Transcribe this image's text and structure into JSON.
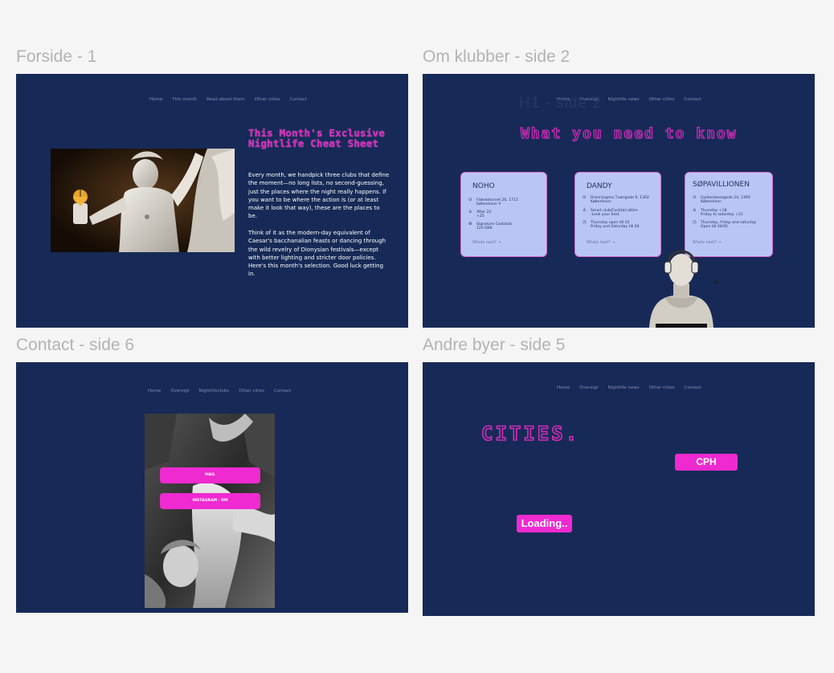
{
  "labels": {
    "frame1": "Forside - 1",
    "frame2": "Om klubber - side 2",
    "frame6": "Contact - side 6",
    "frame5": "Andre byer - side 5"
  },
  "frame1": {
    "nav": [
      "Home",
      "This month",
      "Read about them",
      "Other cities",
      "Contact"
    ],
    "heading": "This Month's Exclusive Nightlife Cheat Sheet",
    "para1": "Every month, we handpick three clubs that define the moment—no long lists, no second-guessing, just the places where the night really happens. If you want to be where the action is (or at least make it look that way), these are the places to be.",
    "para2": "Think of it as the modern-day equivalent of Caesar's bacchanalian feasts or dancing through the wild revelry of Dionysian festivals—except with better lighting and stricter door policies. Here's this month's selection. Good luck getting in."
  },
  "frame2": {
    "nav": [
      "Home",
      "Oversigt",
      "Nightlife news",
      "Other cities",
      "Contact"
    ],
    "ghost_heading": "H1 - side 2",
    "heading": "What you need to know",
    "cards": [
      {
        "title": "NOHO",
        "rows": [
          {
            "icon": "location-icon",
            "glyph": "⊙",
            "text": "Flæsketorvet 26, 1711\nKøbenhavn V"
          },
          {
            "icon": "person-icon",
            "glyph": "♙",
            "text": "After 22\n+25"
          },
          {
            "icon": "money-icon",
            "glyph": "⊛",
            "text": "Signature Cocktails\n120 DKK"
          }
        ],
        "link": "Whats next? →"
      },
      {
        "title": "DANDY",
        "rows": [
          {
            "icon": "location-icon",
            "glyph": "⊙",
            "text": "Dronningens Tværgade 9, 1302\nKøbenhavn"
          },
          {
            "icon": "person-icon",
            "glyph": "♙",
            "text": "Smart club/Cocktail attire\n-Look your best"
          },
          {
            "icon": "clock-icon",
            "glyph": "◷",
            "text": "Thursday open till 01\nFriday and Saturday till 04"
          }
        ],
        "link": "Whats next? →"
      },
      {
        "title": "SØPAVILLIONEN",
        "rows": [
          {
            "icon": "location-icon",
            "glyph": "⊙",
            "text": "Gyldenløvesgade 24, 1369\nKøbenhavn"
          },
          {
            "icon": "person-icon",
            "glyph": "♙",
            "text": "Thursday +18\nFriday to saturday +21"
          },
          {
            "icon": "clock-icon",
            "glyph": "◷",
            "text": "Thursday, friday and saturday\nOpen till 04/05"
          }
        ],
        "link": "Whats next? →"
      }
    ]
  },
  "frame6": {
    "nav": [
      "Home",
      "Oversigt",
      "Nightlifeclubs",
      "Other cities",
      "Contact"
    ],
    "buttons": [
      "MAIL",
      "INSTAGRAM - DM"
    ]
  },
  "frame5": {
    "nav": [
      "Home",
      "Oversigt",
      "Nightlife news",
      "Other cities",
      "Contact"
    ],
    "heading": "CITIES.",
    "city_button": "CPH",
    "loading": "Loading.."
  }
}
